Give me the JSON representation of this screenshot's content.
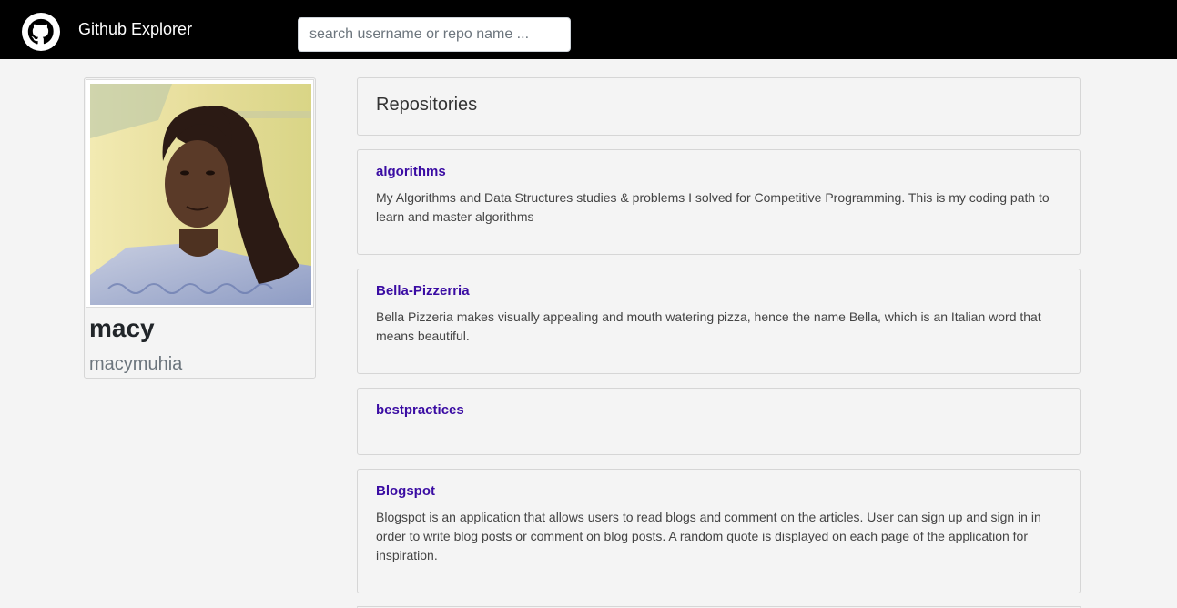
{
  "navbar": {
    "title": "Github Explorer",
    "search_placeholder": "search username or repo name ...",
    "logo_icon": "github-octocat-icon"
  },
  "profile": {
    "name": "macy",
    "login": "macymuhia"
  },
  "repositories": {
    "heading": "Repositories",
    "items": [
      {
        "name": "algorithms",
        "description": "My Algorithms and Data Structures studies & problems I solved for Competitive Programming. This is my coding path to learn and master algorithms"
      },
      {
        "name": "Bella-Pizzerria",
        "description": "Bella Pizzeria makes visually appealing and mouth watering pizza, hence the name Bella, which is an Italian word that means beautiful."
      },
      {
        "name": "bestpractices",
        "description": ""
      },
      {
        "name": "Blogspot",
        "description": "Blogspot is an application that allows users to read blogs and comment on the articles. User can sign up and sign in in order to write blog posts or comment on blog posts. A random quote is displayed on each page of the application for inspiration."
      }
    ]
  },
  "colors": {
    "navbar_bg": "#000000",
    "page_bg": "#f4f4f4",
    "repo_link": "#3a0ca3"
  }
}
